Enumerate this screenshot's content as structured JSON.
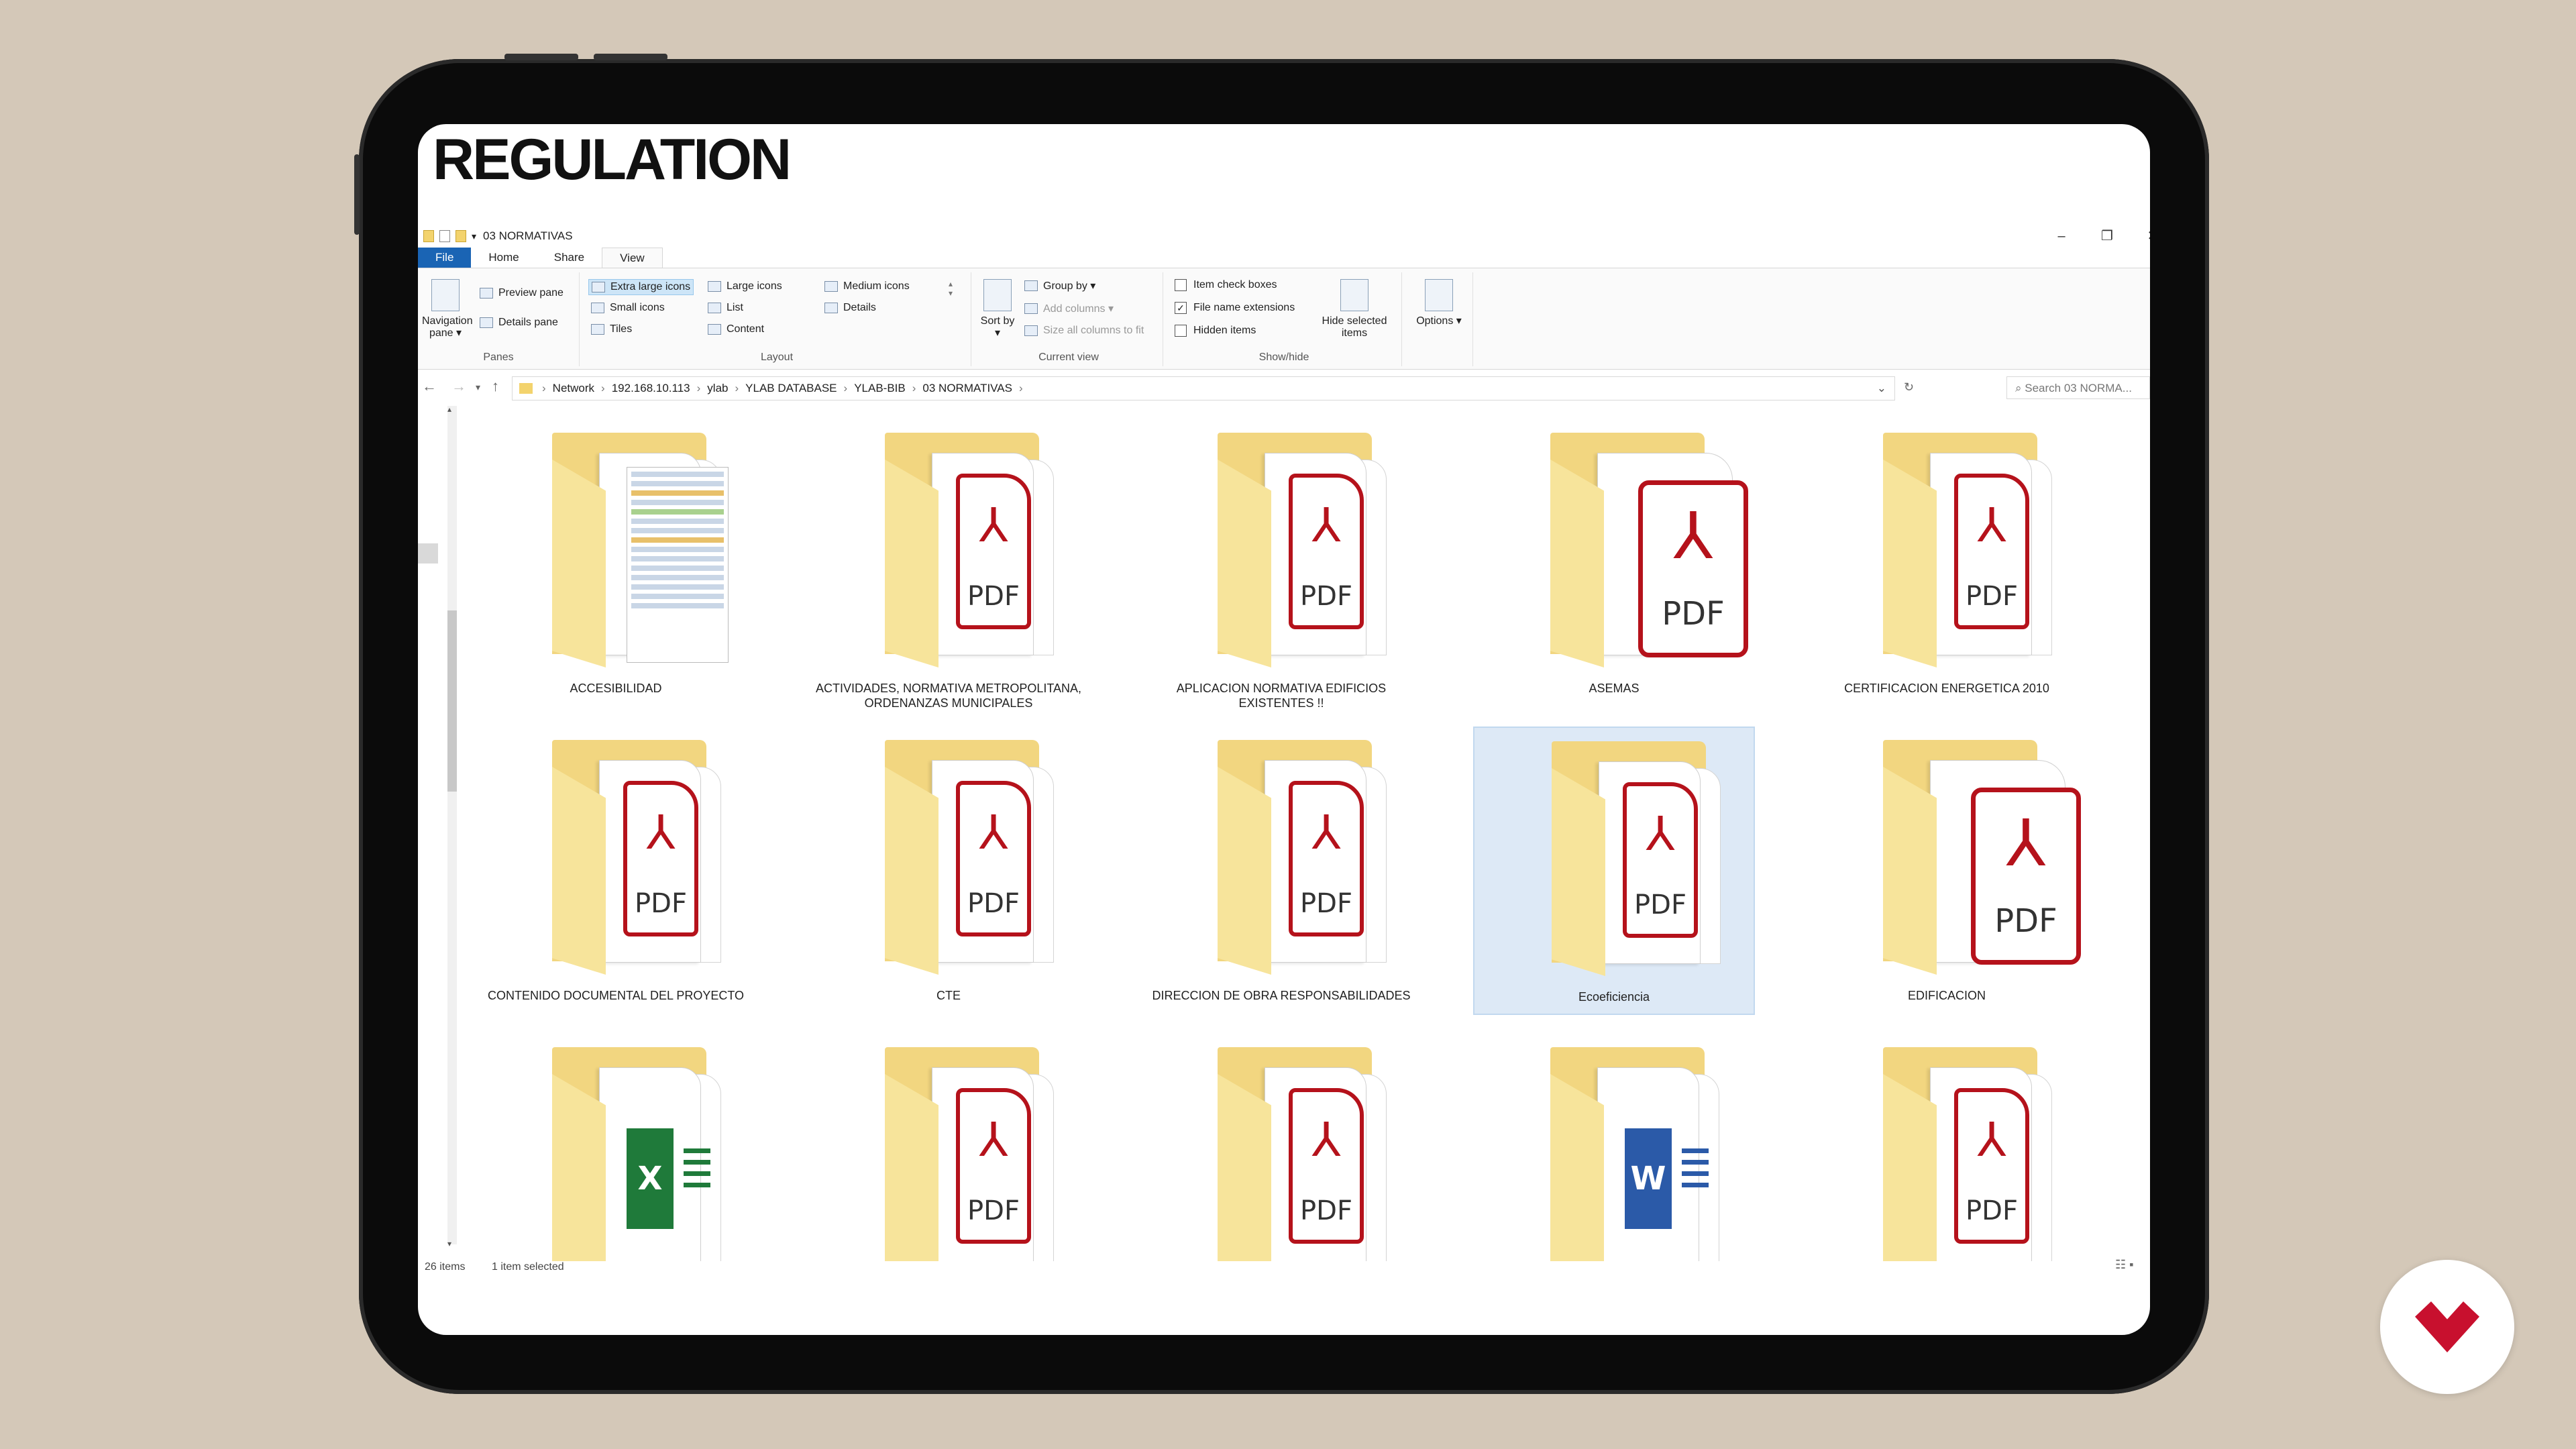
{
  "headline": "REGULATION",
  "window": {
    "title": "03 NORMATIVAS",
    "controls": {
      "minimize": "–",
      "restore": "❐",
      "close": "✕"
    }
  },
  "tabs": [
    {
      "label": "File"
    },
    {
      "label": "Home"
    },
    {
      "label": "Share"
    },
    {
      "label": "View"
    }
  ],
  "ribbon": {
    "panes": {
      "navigation_pane": "Navigation pane ▾",
      "preview_pane": "Preview pane",
      "details_pane": "Details pane",
      "group_label": "Panes"
    },
    "layout": {
      "extra_large_icons": "Extra large icons",
      "large_icons": "Large icons",
      "medium_icons": "Medium icons",
      "small_icons": "Small icons",
      "list": "List",
      "details": "Details",
      "tiles": "Tiles",
      "content": "Content",
      "group_label": "Layout"
    },
    "current_view": {
      "sort_by": "Sort by ▾",
      "group_by": "Group by ▾",
      "add_columns": "Add columns ▾",
      "size_all_columns": "Size all columns to fit",
      "group_label": "Current view"
    },
    "show_hide": {
      "item_check_boxes": "Item check boxes",
      "file_name_extensions": "File name extensions",
      "hidden_items": "Hidden items",
      "hide_selected_items": "Hide selected items",
      "group_label": "Show/hide",
      "checks": {
        "item_check_boxes": false,
        "file_name_extensions": true,
        "hidden_items": false
      }
    },
    "options": "Options ▾"
  },
  "address": {
    "crumbs": [
      "Network",
      "192.168.10.113",
      "ylab",
      "YLAB DATABASE",
      "YLAB-BIB",
      "03 NORMATIVAS"
    ],
    "search_placeholder": "Search 03 NORMA..."
  },
  "items": [
    {
      "name": "ACCESIBILIDAD",
      "icon": "sheet",
      "selected": false
    },
    {
      "name": "ACTIVIDADES, NORMATIVA METROPOLITANA, ORDENANZAS MUNICIPALES",
      "icon": "pdf",
      "selected": false
    },
    {
      "name": "APLICACION NORMATIVA EDIFICIOS EXISTENTES !!",
      "icon": "pdf",
      "selected": false
    },
    {
      "name": "ASEMAS",
      "icon": "pdf-big",
      "selected": false
    },
    {
      "name": "CERTIFICACION ENERGETICA 2010",
      "icon": "pdf",
      "selected": false
    },
    {
      "name": "CONTENIDO DOCUMENTAL DEL PROYECTO",
      "icon": "pdf",
      "selected": false
    },
    {
      "name": "CTE",
      "icon": "pdf",
      "selected": false
    },
    {
      "name": "DIRECCION DE OBRA RESPONSABILIDADES",
      "icon": "pdf",
      "selected": false
    },
    {
      "name": "Ecoeficiencia",
      "icon": "pdf",
      "selected": true
    },
    {
      "name": "EDIFICACION",
      "icon": "pdf-big",
      "selected": false
    },
    {
      "name": "",
      "icon": "excel",
      "selected": false
    },
    {
      "name": "",
      "icon": "pdf",
      "selected": false
    },
    {
      "name": "",
      "icon": "pdf",
      "selected": false
    },
    {
      "name": "",
      "icon": "word",
      "selected": false
    },
    {
      "name": "",
      "icon": "pdf",
      "selected": false
    }
  ],
  "status": {
    "count": "26 items",
    "selection": "1 item selected"
  },
  "colors": {
    "accent": "#1a64b4",
    "pdf_red": "#b5121b",
    "brand": "#c8102e"
  }
}
